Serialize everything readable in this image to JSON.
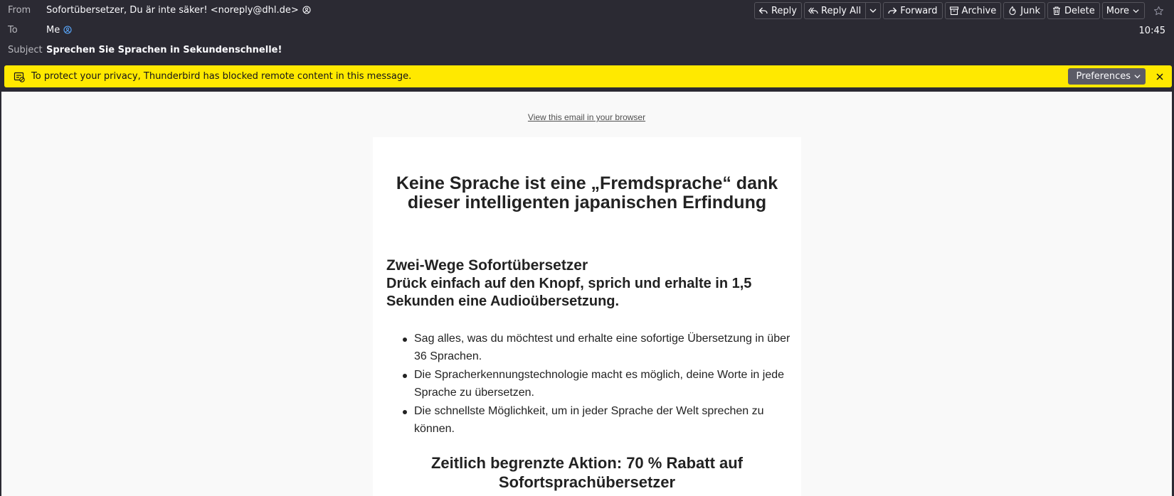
{
  "header": {
    "from_label": "From",
    "from_value": "Sofortübersetzer, Du är inte säker! <noreply@dhl.de>",
    "to_label": "To",
    "to_value": "Me",
    "subject_label": "Subject",
    "subject_value": "Sprechen Sie Sprachen in Sekundenschnelle!",
    "date": "10:45"
  },
  "toolbar": {
    "reply": "Reply",
    "reply_all": "Reply All",
    "forward": "Forward",
    "archive": "Archive",
    "junk": "Junk",
    "delete": "Delete",
    "more": "More"
  },
  "notice": {
    "text": "To protect your privacy, Thunderbird has blocked remote content in this message.",
    "preferences": "Preferences",
    "color": "#ffe900"
  },
  "email": {
    "view_in_browser": "View this email in your browser",
    "headline": "Keine Sprache ist eine „Fremdsprache“ dank dieser intelligenten japanischen Erfindung",
    "product_title": "Zwei-Wege Sofortübersetzer",
    "product_subtitle": "Drück einfach auf den Knopf, sprich und erhalte in 1,5 Sekunden eine Audioübersetzung.",
    "bullets": [
      "Sag alles, was du möchtest und erhalte eine sofortige Übersetzung in über 36 Sprachen.",
      "Die Spracherkennungstechnologie macht es möglich, deine Worte in jede Sprache zu übersetzen.",
      "Die schnellste Möglichkeit, um in jeder Sprache der Welt sprechen zu können."
    ],
    "offer": "Zeitlich begrenzte Aktion: 70 % Rabatt auf Sofortsprachübersetzer"
  }
}
